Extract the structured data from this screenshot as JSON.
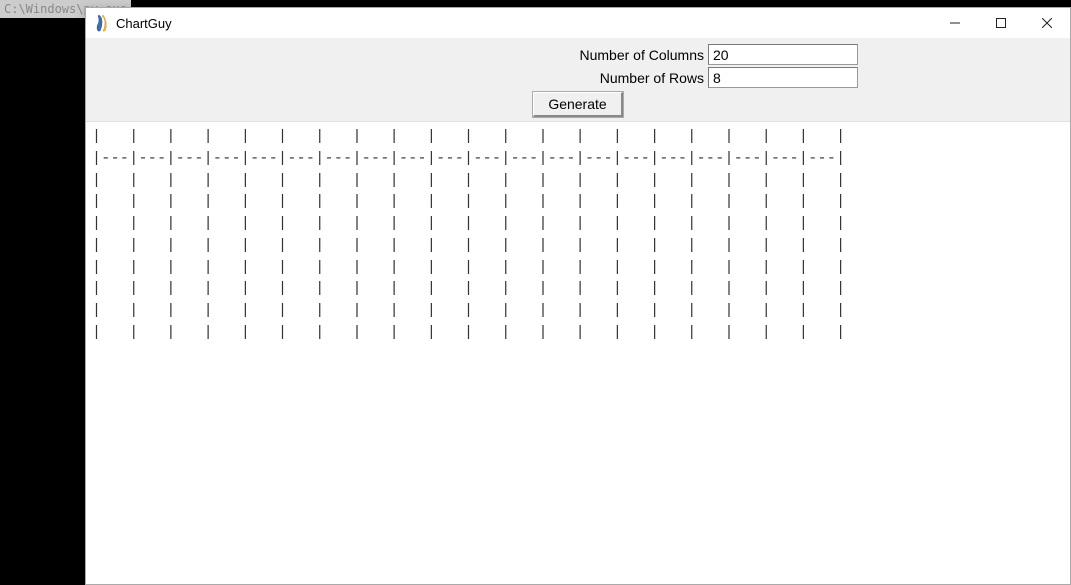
{
  "background": {
    "text": "C:\\Windows\\py.exe"
  },
  "window": {
    "title": "ChartGuy"
  },
  "form": {
    "columnsLabel": "Number of Columns",
    "columnsValue": "20",
    "rowsLabel": "Number of Rows",
    "rowsValue": "8",
    "generateLabel": "Generate"
  },
  "grid": {
    "columns": 20,
    "rows": 8
  }
}
